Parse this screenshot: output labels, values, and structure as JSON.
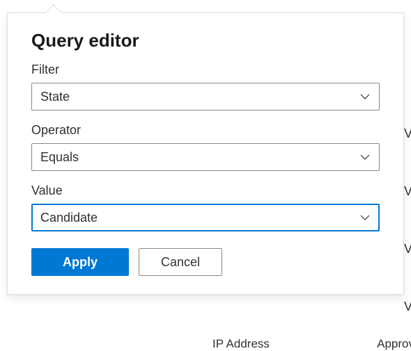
{
  "panel": {
    "title": "Query editor",
    "filter": {
      "label": "Filter",
      "value": "State"
    },
    "operator": {
      "label": "Operator",
      "value": "Equals"
    },
    "value": {
      "label": "Value",
      "value": "Candidate"
    },
    "buttons": {
      "apply": "Apply",
      "cancel": "Cancel"
    }
  },
  "background": {
    "partial_right": "V",
    "partial_bottom_left": "IP Address",
    "partial_bottom_right": "Approv"
  }
}
